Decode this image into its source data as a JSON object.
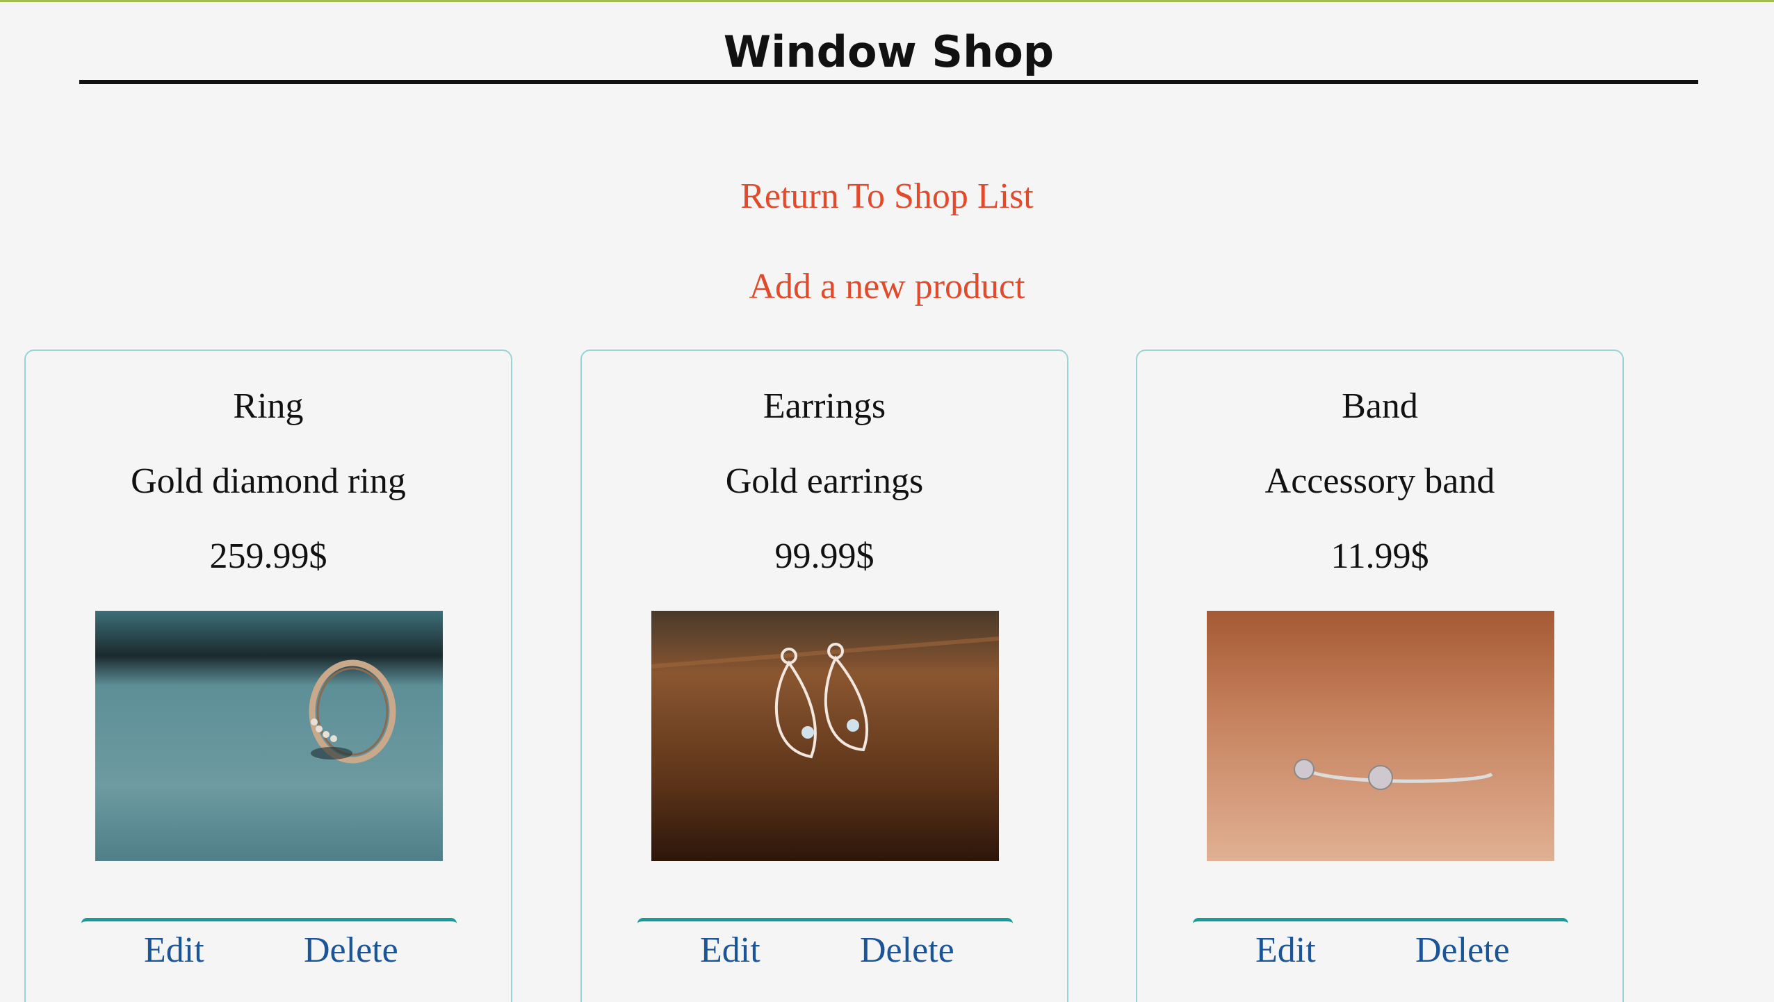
{
  "header": {
    "title": "Window Shop"
  },
  "nav": {
    "return_label": "Return To Shop List",
    "add_label": "Add a new product"
  },
  "colors": {
    "top_bar": "#a2bd52",
    "link": "#e24a2c",
    "action_link": "#1a5597",
    "card_border": "#9ad3d6",
    "action_bar": "#1a9a9a"
  },
  "products": [
    {
      "name": "Ring",
      "description": "Gold diamond ring",
      "price": "259.99$",
      "image_icon": "ring-photo",
      "edit_label": "Edit",
      "delete_label": "Delete"
    },
    {
      "name": "Earrings",
      "description": "Gold earrings",
      "price": "99.99$",
      "image_icon": "earrings-photo",
      "edit_label": "Edit",
      "delete_label": "Delete"
    },
    {
      "name": "Band",
      "description": "Accessory band",
      "price": "11.99$",
      "image_icon": "band-photo",
      "edit_label": "Edit",
      "delete_label": "Delete"
    }
  ]
}
